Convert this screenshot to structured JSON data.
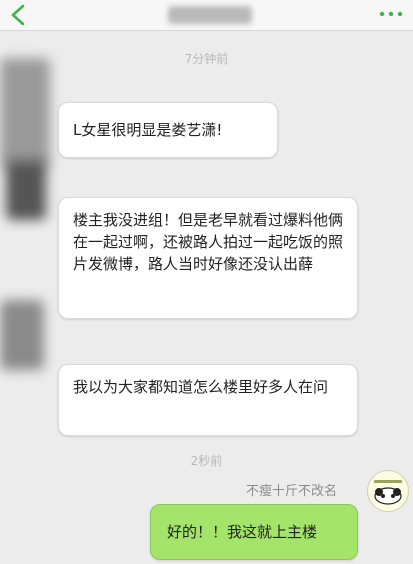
{
  "header": {
    "back_icon": "chevron-left-icon",
    "more_icon": "more-dots-icon"
  },
  "timestamps": [
    "7分钟前",
    "2秒前"
  ],
  "messages": [
    {
      "text": "L女星很明显是娄艺潇!"
    },
    {
      "text": "楼主我没进组！但是老早就看过爆料他俩在一起过啊，还被路人拍过一起吃饭的照片发微博，路人当时好像还没认出薛"
    },
    {
      "text": "我以为大家都知道怎么楼里好多人在问"
    }
  ],
  "self_message": {
    "sender": "不瘦十斤不改名",
    "text": "好的！！我这就上主楼"
  },
  "colors": {
    "accent_green": "#3fb34f",
    "self_bubble": "#a4e46a",
    "background": "#ececec"
  }
}
